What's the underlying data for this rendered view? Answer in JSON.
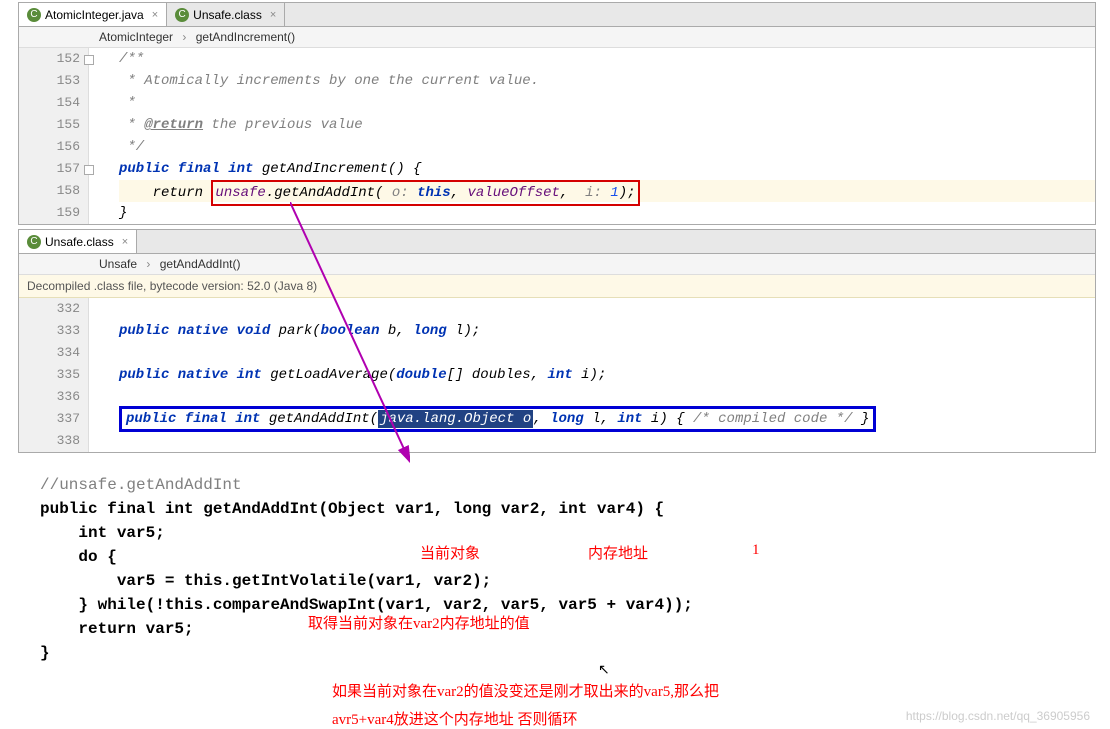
{
  "pane1": {
    "tabs": [
      {
        "label": "AtomicInteger.java",
        "active": true
      },
      {
        "label": "Unsafe.class",
        "active": false
      }
    ],
    "breadcrumb": {
      "cls": "AtomicInteger",
      "meth": "getAndIncrement()"
    },
    "lines": {
      "152": "/**",
      "153": " * Atomically increments by one the current value.",
      "154": " *",
      "155_pre": " * ",
      "155_tag": "@return",
      "155_post": " the previous value",
      "156": " */",
      "157_kw": "public final int ",
      "157_meth": "getAndIncrement() {",
      "158_pre": "    return ",
      "158_unsafe": "unsafe",
      "158_dot": ".getAndAddInt( ",
      "158_p1": "o: ",
      "158_this": "this",
      "158_c": ", ",
      "158_vo": "valueOffset",
      "158_c2": ",  ",
      "158_p2": "i: ",
      "158_one": "1",
      "158_end": ");",
      "159": "}"
    },
    "line_numbers": [
      "152",
      "153",
      "154",
      "155",
      "156",
      "157",
      "158",
      "159"
    ]
  },
  "pane2": {
    "tabs": [
      {
        "label": "Unsafe.class",
        "active": true
      }
    ],
    "breadcrumb": {
      "cls": "Unsafe",
      "meth": "getAndAddInt()"
    },
    "notice": "Decompiled .class file, bytecode version: 52.0 (Java 8)",
    "line_numbers": [
      "332",
      "333",
      "334",
      "335",
      "336",
      "337",
      "338"
    ],
    "l333": {
      "kw": "public native void ",
      "meth": "park(",
      "kw2": "boolean",
      "p": " b, ",
      "kw3": "long",
      "p2": " l);"
    },
    "l335": {
      "kw": "public native int ",
      "meth": "getLoadAverage(",
      "kw2": "double",
      "p": "[] doubles, ",
      "kw3": "int",
      "p2": " i);"
    },
    "l337": {
      "kw": "public final int ",
      "meth": "getAndAddInt(",
      "sel": "java.lang.Object o",
      "c": ", ",
      "kw2": "long",
      "p": " l, ",
      "kw3": "int",
      "p2": " i) { ",
      "cmt": "/* compiled code */",
      "end": " }"
    }
  },
  "decompiled": {
    "l1": "//unsafe.getAndAddInt",
    "l2": {
      "pre": "public final int ",
      "meth": "getAndAddInt(Object var1, ",
      "long": "long",
      "mid": " var2, ",
      "int": "int",
      "end": " var4) {"
    },
    "l3": "    int var5;",
    "l4": "    do {",
    "l5": "        var5 = this.getIntVolatile(var1, var2);",
    "l6": "    } while(!this.compareAndSwapInt(var1, var2, var5, var5 + var4));",
    "l7": "    return var5;",
    "l8": "}"
  },
  "annotations": {
    "a1": "当前对象",
    "a2": "内存地址",
    "a3": "1",
    "a4": "取得当前对象在var2内存地址的值",
    "a5": "如果当前对象在var2的值没变还是刚才取出来的var5,那么把",
    "a6": "avr5+var4放进这个内存地址 否则循环"
  },
  "watermark": "https://blog.csdn.net/qq_36905956"
}
